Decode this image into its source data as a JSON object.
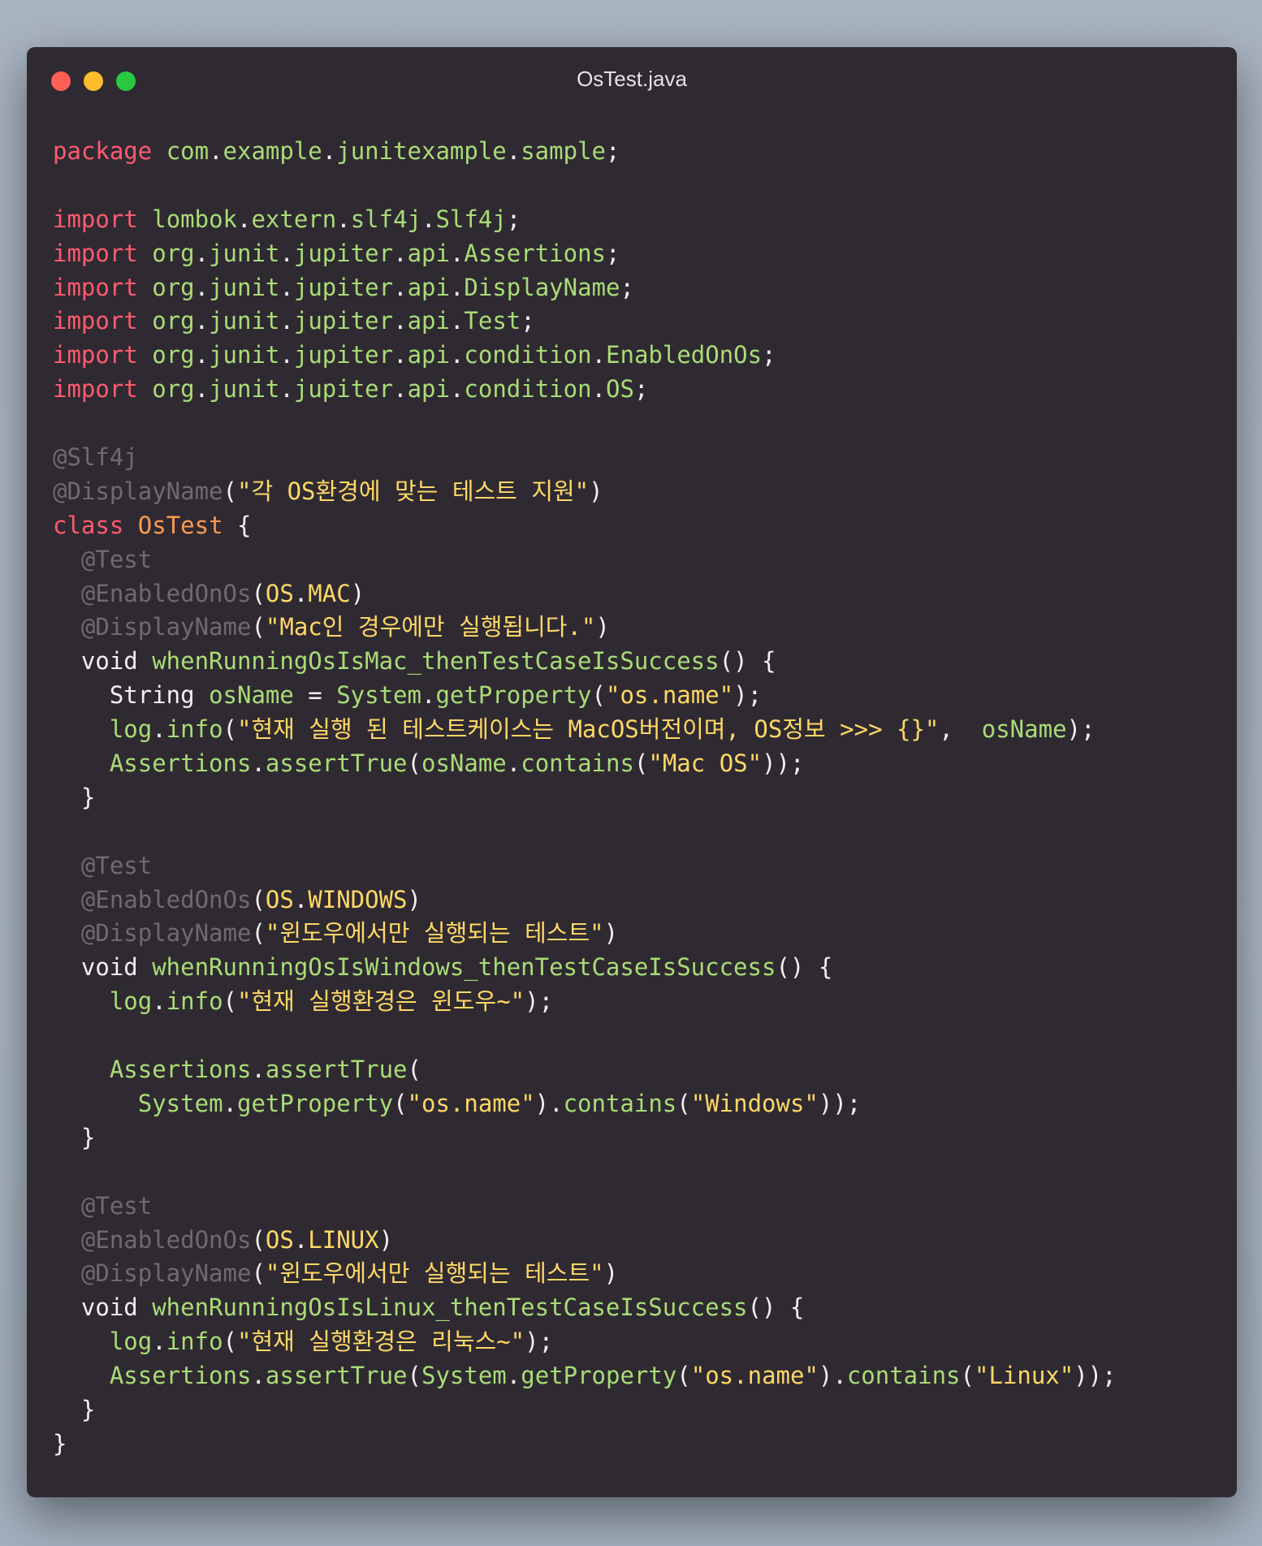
{
  "window": {
    "title": "OsTest.java",
    "controls": [
      "close",
      "minimize",
      "maximize"
    ]
  },
  "colors": {
    "background": "#2f2a32",
    "keyword": "#ff5a6e",
    "type": "#ff9a4f",
    "identifier": "#a9dc76",
    "annotation": "#6e6972",
    "string": "#ffd866",
    "plain": "#f4eef3"
  },
  "code": {
    "lines": [
      [
        [
          "kw",
          "package"
        ],
        [
          "plain",
          " "
        ],
        [
          "pkg",
          "com"
        ],
        [
          "punct",
          "."
        ],
        [
          "pkg",
          "example"
        ],
        [
          "punct",
          "."
        ],
        [
          "pkg",
          "junitexample"
        ],
        [
          "punct",
          "."
        ],
        [
          "pkg",
          "sample"
        ],
        [
          "punct",
          ";"
        ]
      ],
      [],
      [
        [
          "kw",
          "import"
        ],
        [
          "plain",
          " "
        ],
        [
          "pkg",
          "lombok"
        ],
        [
          "punct",
          "."
        ],
        [
          "pkg",
          "extern"
        ],
        [
          "punct",
          "."
        ],
        [
          "pkg",
          "slf4j"
        ],
        [
          "punct",
          "."
        ],
        [
          "pkg",
          "Slf4j"
        ],
        [
          "punct",
          ";"
        ]
      ],
      [
        [
          "kw",
          "import"
        ],
        [
          "plain",
          " "
        ],
        [
          "pkg",
          "org"
        ],
        [
          "punct",
          "."
        ],
        [
          "pkg",
          "junit"
        ],
        [
          "punct",
          "."
        ],
        [
          "pkg",
          "jupiter"
        ],
        [
          "punct",
          "."
        ],
        [
          "pkg",
          "api"
        ],
        [
          "punct",
          "."
        ],
        [
          "pkg",
          "Assertions"
        ],
        [
          "punct",
          ";"
        ]
      ],
      [
        [
          "kw",
          "import"
        ],
        [
          "plain",
          " "
        ],
        [
          "pkg",
          "org"
        ],
        [
          "punct",
          "."
        ],
        [
          "pkg",
          "junit"
        ],
        [
          "punct",
          "."
        ],
        [
          "pkg",
          "jupiter"
        ],
        [
          "punct",
          "."
        ],
        [
          "pkg",
          "api"
        ],
        [
          "punct",
          "."
        ],
        [
          "pkg",
          "DisplayName"
        ],
        [
          "punct",
          ";"
        ]
      ],
      [
        [
          "kw",
          "import"
        ],
        [
          "plain",
          " "
        ],
        [
          "pkg",
          "org"
        ],
        [
          "punct",
          "."
        ],
        [
          "pkg",
          "junit"
        ],
        [
          "punct",
          "."
        ],
        [
          "pkg",
          "jupiter"
        ],
        [
          "punct",
          "."
        ],
        [
          "pkg",
          "api"
        ],
        [
          "punct",
          "."
        ],
        [
          "pkg",
          "Test"
        ],
        [
          "punct",
          ";"
        ]
      ],
      [
        [
          "kw",
          "import"
        ],
        [
          "plain",
          " "
        ],
        [
          "pkg",
          "org"
        ],
        [
          "punct",
          "."
        ],
        [
          "pkg",
          "junit"
        ],
        [
          "punct",
          "."
        ],
        [
          "pkg",
          "jupiter"
        ],
        [
          "punct",
          "."
        ],
        [
          "pkg",
          "api"
        ],
        [
          "punct",
          "."
        ],
        [
          "pkg",
          "condition"
        ],
        [
          "punct",
          "."
        ],
        [
          "pkg",
          "EnabledOnOs"
        ],
        [
          "punct",
          ";"
        ]
      ],
      [
        [
          "kw",
          "import"
        ],
        [
          "plain",
          " "
        ],
        [
          "pkg",
          "org"
        ],
        [
          "punct",
          "."
        ],
        [
          "pkg",
          "junit"
        ],
        [
          "punct",
          "."
        ],
        [
          "pkg",
          "jupiter"
        ],
        [
          "punct",
          "."
        ],
        [
          "pkg",
          "api"
        ],
        [
          "punct",
          "."
        ],
        [
          "pkg",
          "condition"
        ],
        [
          "punct",
          "."
        ],
        [
          "pkg",
          "OS"
        ],
        [
          "punct",
          ";"
        ]
      ],
      [],
      [
        [
          "ann",
          "@Slf4j"
        ]
      ],
      [
        [
          "ann",
          "@DisplayName"
        ],
        [
          "punct",
          "("
        ],
        [
          "str",
          "\"각 OS환경에 맞는 테스트 지원\""
        ],
        [
          "punct",
          ")"
        ]
      ],
      [
        [
          "kw",
          "class"
        ],
        [
          "plain",
          " "
        ],
        [
          "type",
          "OsTest"
        ],
        [
          "plain",
          " {"
        ]
      ],
      [
        [
          "plain",
          "  "
        ],
        [
          "ann",
          "@Test"
        ]
      ],
      [
        [
          "plain",
          "  "
        ],
        [
          "ann",
          "@EnabledOnOs"
        ],
        [
          "punct",
          "("
        ],
        [
          "str",
          "OS"
        ],
        [
          "punct",
          "."
        ],
        [
          "str",
          "MAC"
        ],
        [
          "punct",
          ")"
        ]
      ],
      [
        [
          "plain",
          "  "
        ],
        [
          "ann",
          "@DisplayName"
        ],
        [
          "punct",
          "("
        ],
        [
          "str",
          "\"Mac인 경우에만 실행됩니다.\""
        ],
        [
          "punct",
          ")"
        ]
      ],
      [
        [
          "plain",
          "  void "
        ],
        [
          "fn",
          "whenRunningOsIsMac_thenTestCaseIsSuccess"
        ],
        [
          "plain",
          "() {"
        ]
      ],
      [
        [
          "plain",
          "    String "
        ],
        [
          "var",
          "osName"
        ],
        [
          "plain",
          " = "
        ],
        [
          "fn",
          "System"
        ],
        [
          "punct",
          "."
        ],
        [
          "fn",
          "getProperty"
        ],
        [
          "punct",
          "("
        ],
        [
          "str",
          "\"os.name\""
        ],
        [
          "punct",
          ");"
        ]
      ],
      [
        [
          "plain",
          "    "
        ],
        [
          "fn",
          "log"
        ],
        [
          "punct",
          "."
        ],
        [
          "fn",
          "info"
        ],
        [
          "punct",
          "("
        ],
        [
          "str",
          "\"현재 실행 된 테스트케이스는 MacOS버전이며, OS정보 >>> {}\""
        ],
        [
          "punct",
          ",  "
        ],
        [
          "var",
          "osName"
        ],
        [
          "punct",
          ");"
        ]
      ],
      [
        [
          "plain",
          "    "
        ],
        [
          "fn",
          "Assertions"
        ],
        [
          "punct",
          "."
        ],
        [
          "fn",
          "assertTrue"
        ],
        [
          "punct",
          "("
        ],
        [
          "var",
          "osName"
        ],
        [
          "punct",
          "."
        ],
        [
          "fn",
          "contains"
        ],
        [
          "punct",
          "("
        ],
        [
          "str",
          "\"Mac OS\""
        ],
        [
          "punct",
          "));"
        ]
      ],
      [
        [
          "plain",
          "  }"
        ]
      ],
      [],
      [
        [
          "plain",
          "  "
        ],
        [
          "ann",
          "@Test"
        ]
      ],
      [
        [
          "plain",
          "  "
        ],
        [
          "ann",
          "@EnabledOnOs"
        ],
        [
          "punct",
          "("
        ],
        [
          "str",
          "OS"
        ],
        [
          "punct",
          "."
        ],
        [
          "str",
          "WINDOWS"
        ],
        [
          "punct",
          ")"
        ]
      ],
      [
        [
          "plain",
          "  "
        ],
        [
          "ann",
          "@DisplayName"
        ],
        [
          "punct",
          "("
        ],
        [
          "str",
          "\"윈도우에서만 실행되는 테스트\""
        ],
        [
          "punct",
          ")"
        ]
      ],
      [
        [
          "plain",
          "  void "
        ],
        [
          "fn",
          "whenRunningOsIsWindows_thenTestCaseIsSuccess"
        ],
        [
          "plain",
          "() {"
        ]
      ],
      [
        [
          "plain",
          "    "
        ],
        [
          "fn",
          "log"
        ],
        [
          "punct",
          "."
        ],
        [
          "fn",
          "info"
        ],
        [
          "punct",
          "("
        ],
        [
          "str",
          "\"현재 실행환경은 윈도우~\""
        ],
        [
          "punct",
          ");"
        ]
      ],
      [],
      [
        [
          "plain",
          "    "
        ],
        [
          "fn",
          "Assertions"
        ],
        [
          "punct",
          "."
        ],
        [
          "fn",
          "assertTrue"
        ],
        [
          "punct",
          "("
        ]
      ],
      [
        [
          "plain",
          "      "
        ],
        [
          "fn",
          "System"
        ],
        [
          "punct",
          "."
        ],
        [
          "fn",
          "getProperty"
        ],
        [
          "punct",
          "("
        ],
        [
          "str",
          "\"os.name\""
        ],
        [
          "punct",
          ")."
        ],
        [
          "fn",
          "contains"
        ],
        [
          "punct",
          "("
        ],
        [
          "str",
          "\"Windows\""
        ],
        [
          "punct",
          "));"
        ]
      ],
      [
        [
          "plain",
          "  }"
        ]
      ],
      [],
      [
        [
          "plain",
          "  "
        ],
        [
          "ann",
          "@Test"
        ]
      ],
      [
        [
          "plain",
          "  "
        ],
        [
          "ann",
          "@EnabledOnOs"
        ],
        [
          "punct",
          "("
        ],
        [
          "str",
          "OS"
        ],
        [
          "punct",
          "."
        ],
        [
          "str",
          "LINUX"
        ],
        [
          "punct",
          ")"
        ]
      ],
      [
        [
          "plain",
          "  "
        ],
        [
          "ann",
          "@DisplayName"
        ],
        [
          "punct",
          "("
        ],
        [
          "str",
          "\"윈도우에서만 실행되는 테스트\""
        ],
        [
          "punct",
          ")"
        ]
      ],
      [
        [
          "plain",
          "  void "
        ],
        [
          "fn",
          "whenRunningOsIsLinux_thenTestCaseIsSuccess"
        ],
        [
          "plain",
          "() {"
        ]
      ],
      [
        [
          "plain",
          "    "
        ],
        [
          "fn",
          "log"
        ],
        [
          "punct",
          "."
        ],
        [
          "fn",
          "info"
        ],
        [
          "punct",
          "("
        ],
        [
          "str",
          "\"현재 실행환경은 리눅스~\""
        ],
        [
          "punct",
          ");"
        ]
      ],
      [
        [
          "plain",
          "    "
        ],
        [
          "fn",
          "Assertions"
        ],
        [
          "punct",
          "."
        ],
        [
          "fn",
          "assertTrue"
        ],
        [
          "punct",
          "("
        ],
        [
          "fn",
          "System"
        ],
        [
          "punct",
          "."
        ],
        [
          "fn",
          "getProperty"
        ],
        [
          "punct",
          "("
        ],
        [
          "str",
          "\"os.name\""
        ],
        [
          "punct",
          ")."
        ],
        [
          "fn",
          "contains"
        ],
        [
          "punct",
          "("
        ],
        [
          "str",
          "\"Linux\""
        ],
        [
          "punct",
          "));"
        ]
      ],
      [
        [
          "plain",
          "  }"
        ]
      ],
      [
        [
          "plain",
          "}"
        ]
      ]
    ]
  }
}
